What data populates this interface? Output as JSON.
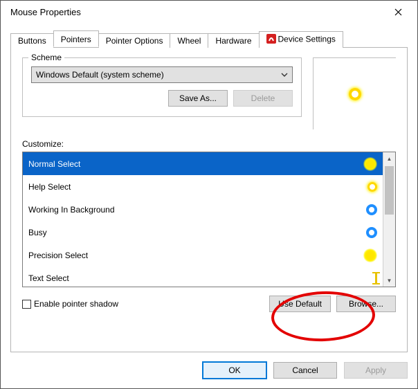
{
  "window": {
    "title": "Mouse Properties"
  },
  "tabs": [
    {
      "label": "Buttons"
    },
    {
      "label": "Pointers",
      "active": true
    },
    {
      "label": "Pointer Options"
    },
    {
      "label": "Wheel"
    },
    {
      "label": "Hardware"
    },
    {
      "label": "Device Settings",
      "has_icon": true
    }
  ],
  "scheme": {
    "legend": "Scheme",
    "selected": "Windows Default (system scheme)",
    "save_as_label": "Save As...",
    "delete_label": "Delete",
    "delete_enabled": false
  },
  "customize": {
    "label": "Customize:",
    "items": [
      {
        "label": "Normal Select",
        "icon": "yellow-glow",
        "selected": true
      },
      {
        "label": "Help Select",
        "icon": "yellow-ring"
      },
      {
        "label": "Working In Background",
        "icon": "blue-ring"
      },
      {
        "label": "Busy",
        "icon": "blue-ring"
      },
      {
        "label": "Precision Select",
        "icon": "yellow-glow"
      },
      {
        "label": "Text Select",
        "icon": "ibeam"
      }
    ]
  },
  "enable_shadow": {
    "label": "Enable pointer shadow",
    "checked": false
  },
  "buttons": {
    "use_default": "Use Default",
    "browse": "Browse...",
    "ok": "OK",
    "cancel": "Cancel",
    "apply": "Apply",
    "apply_enabled": false
  },
  "annotation": {
    "target": "browse-button",
    "color": "#e30000"
  }
}
